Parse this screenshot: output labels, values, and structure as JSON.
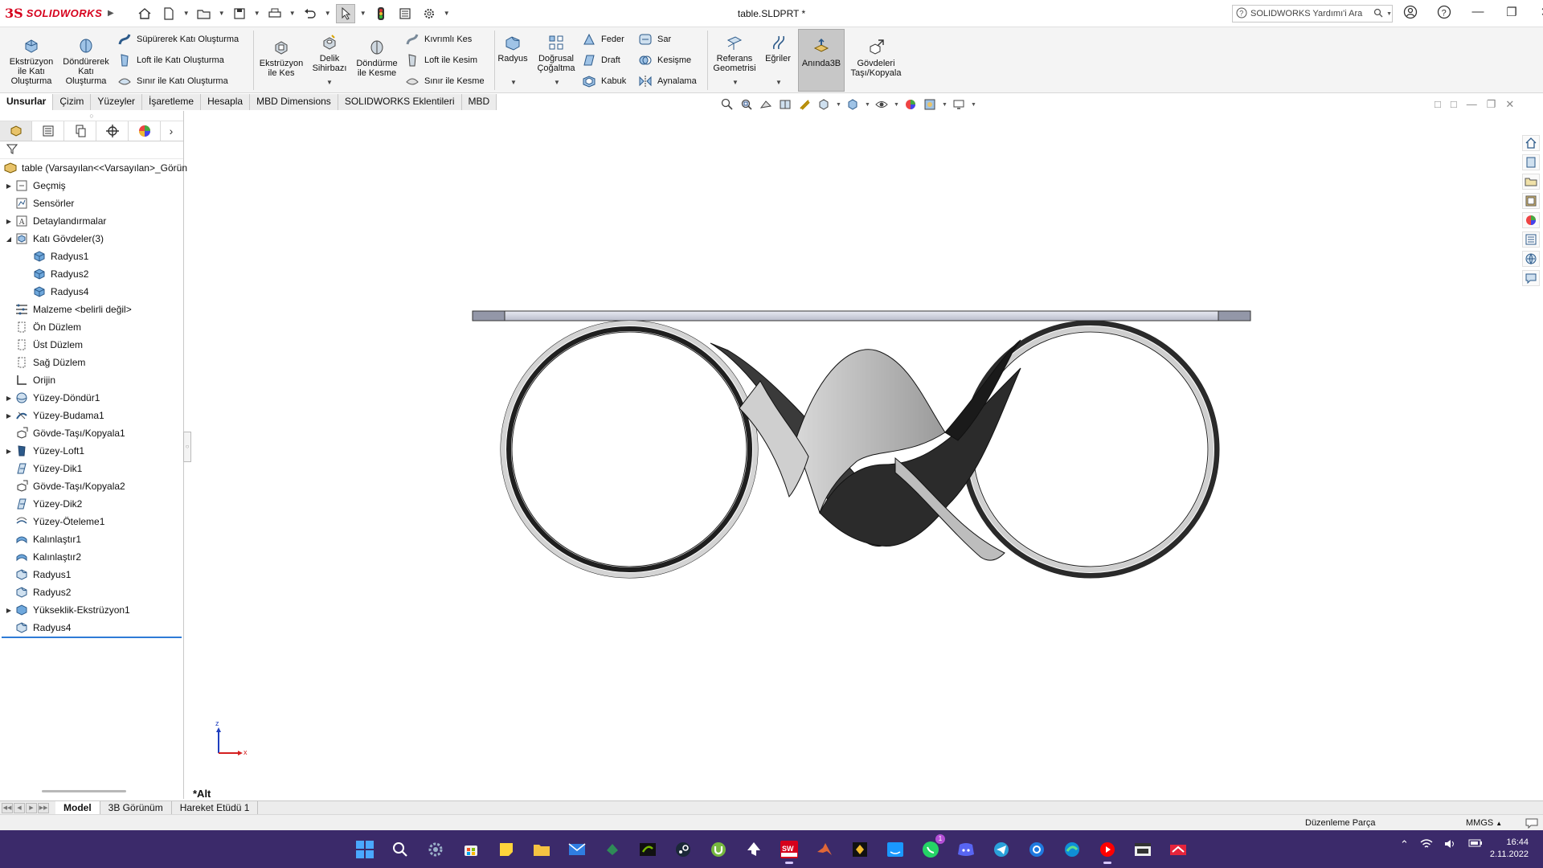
{
  "app": {
    "brand_ds": "3S",
    "brand_name": "SOLIDWORKS",
    "document_title": "table.SLDPRT *"
  },
  "search": {
    "value": "SOLIDWORKS Yardımı'i Ara"
  },
  "ribbon": {
    "large_buttons": [
      {
        "id": "extrude-boss",
        "label": "Ekstrüzyon ile Katı Oluşturma"
      },
      {
        "id": "revolve-boss",
        "label": "Döndürerek Katı Oluşturma"
      },
      {
        "id": "extrude-cut",
        "label": "Ekstrüzyon ile Kes"
      },
      {
        "id": "hole-wizard",
        "label": "Delik Sihirbazı"
      },
      {
        "id": "revolve-cut",
        "label": "Döndürme ile Kesme"
      },
      {
        "id": "fillet",
        "label": "Radyus"
      },
      {
        "id": "linear-pattern",
        "label": "Doğrusal Çoğaltma"
      },
      {
        "id": "reference-geometry",
        "label": "Referans Geometrisi"
      },
      {
        "id": "curves",
        "label": "Eğriler"
      },
      {
        "id": "instant3d",
        "label": "Anında3B"
      },
      {
        "id": "move-copy-bodies",
        "label": "Gövdeleri Taşı/Kopyala"
      }
    ],
    "small_buttons": [
      {
        "id": "swept-boss",
        "label": "Süpürerek Katı Oluşturma"
      },
      {
        "id": "loft-boss",
        "label": "Loft ile Katı Oluşturma"
      },
      {
        "id": "boundary-boss",
        "label": "Sınır ile Katı Oluşturma"
      },
      {
        "id": "swept-cut",
        "label": "Kıvrımlı Kes"
      },
      {
        "id": "loft-cut",
        "label": "Loft ile Kesim"
      },
      {
        "id": "boundary-cut",
        "label": "Sınır ile Kesme"
      },
      {
        "id": "rib",
        "label": "Feder"
      },
      {
        "id": "draft",
        "label": "Draft"
      },
      {
        "id": "shell",
        "label": "Kabuk"
      },
      {
        "id": "wrap",
        "label": "Sar"
      },
      {
        "id": "intersect",
        "label": "Kesişme"
      },
      {
        "id": "mirror",
        "label": "Aynalama"
      }
    ]
  },
  "command_tabs": [
    "Unsurlar",
    "Çizim",
    "Yüzeyler",
    "İşaretleme",
    "Hesapla",
    "MBD Dimensions",
    "SOLIDWORKS Eklentileri",
    "MBD"
  ],
  "tree": {
    "root": "table  (Varsayılan<<Varsayılan>_Görün",
    "items": [
      {
        "label": "Geçmiş",
        "indent": 0,
        "expandable": true,
        "icon": "history-icon"
      },
      {
        "label": "Sensörler",
        "indent": 0,
        "expandable": false,
        "icon": "sensor-icon"
      },
      {
        "label": "Detaylandırmalar",
        "indent": 0,
        "expandable": true,
        "icon": "annotation-icon"
      },
      {
        "label": "Katı Gövdeler(3)",
        "indent": 0,
        "expandable": true,
        "expanded": true,
        "icon": "solid-bodies-icon"
      },
      {
        "label": "Radyus1",
        "indent": 1,
        "expandable": false,
        "icon": "body-icon"
      },
      {
        "label": "Radyus2",
        "indent": 1,
        "expandable": false,
        "icon": "body-icon"
      },
      {
        "label": "Radyus4",
        "indent": 1,
        "expandable": false,
        "icon": "body-icon"
      },
      {
        "label": "Malzeme <belirli değil>",
        "indent": 0,
        "expandable": false,
        "icon": "material-icon"
      },
      {
        "label": "Ön Düzlem",
        "indent": 0,
        "expandable": false,
        "icon": "plane-icon"
      },
      {
        "label": "Üst Düzlem",
        "indent": 0,
        "expandable": false,
        "icon": "plane-icon"
      },
      {
        "label": "Sağ Düzlem",
        "indent": 0,
        "expandable": false,
        "icon": "plane-icon"
      },
      {
        "label": "Orijin",
        "indent": 0,
        "expandable": false,
        "icon": "origin-icon"
      },
      {
        "label": "Yüzey-Döndür1",
        "indent": 0,
        "expandable": true,
        "icon": "surface-revolve-icon"
      },
      {
        "label": "Yüzey-Budama1",
        "indent": 0,
        "expandable": true,
        "icon": "surface-trim-icon"
      },
      {
        "label": "Gövde-Taşı/Kopyala1",
        "indent": 0,
        "expandable": false,
        "icon": "move-body-icon"
      },
      {
        "label": "Yüzey-Loft1",
        "indent": 0,
        "expandable": true,
        "icon": "surface-loft-icon"
      },
      {
        "label": "Yüzey-Dik1",
        "indent": 0,
        "expandable": false,
        "icon": "surface-ruled-icon"
      },
      {
        "label": "Gövde-Taşı/Kopyala2",
        "indent": 0,
        "expandable": false,
        "icon": "move-body-icon"
      },
      {
        "label": "Yüzey-Dik2",
        "indent": 0,
        "expandable": false,
        "icon": "surface-ruled-icon"
      },
      {
        "label": "Yüzey-Öteleme1",
        "indent": 0,
        "expandable": false,
        "icon": "surface-offset-icon"
      },
      {
        "label": "Kalınlaştır1",
        "indent": 0,
        "expandable": false,
        "icon": "thicken-icon"
      },
      {
        "label": "Kalınlaştır2",
        "indent": 0,
        "expandable": false,
        "icon": "thicken-icon"
      },
      {
        "label": "Radyus1",
        "indent": 0,
        "expandable": false,
        "icon": "fillet-icon"
      },
      {
        "label": "Radyus2",
        "indent": 0,
        "expandable": false,
        "icon": "fillet-icon"
      },
      {
        "label": "Yükseklik-Ekstrüzyon1",
        "indent": 0,
        "expandable": true,
        "icon": "extrude-icon"
      },
      {
        "label": "Radyus4",
        "indent": 0,
        "expandable": false,
        "icon": "fillet-icon"
      }
    ]
  },
  "viewport": {
    "view_name": "*Alt",
    "triad_z": "z",
    "triad_x": "x"
  },
  "bottom_tabs": [
    "Model",
    "3B Görünüm",
    "Hareket Etüdü 1"
  ],
  "status": {
    "mode": "Düzenleme Parça",
    "units": "MMGS"
  },
  "taskbar": {
    "apps": [
      "start-icon",
      "search-icon",
      "settings-icon",
      "store-icon",
      "notes-icon",
      "explorer-icon",
      "mail-icon",
      "app-icon",
      "nvidia-icon",
      "steam-icon",
      "utorrent-icon",
      "inkscape-icon",
      "solidworks-icon",
      "matlab-icon",
      "binance-icon",
      "prime-video-icon",
      "whatsapp-icon",
      "discord-icon",
      "telegram-icon",
      "onedrive-icon",
      "edge-icon",
      "youtube-icon",
      "terminal-icon",
      "game-icon"
    ],
    "whatsapp_badge": "1",
    "time": "16:44",
    "date": "2.11.2022"
  }
}
